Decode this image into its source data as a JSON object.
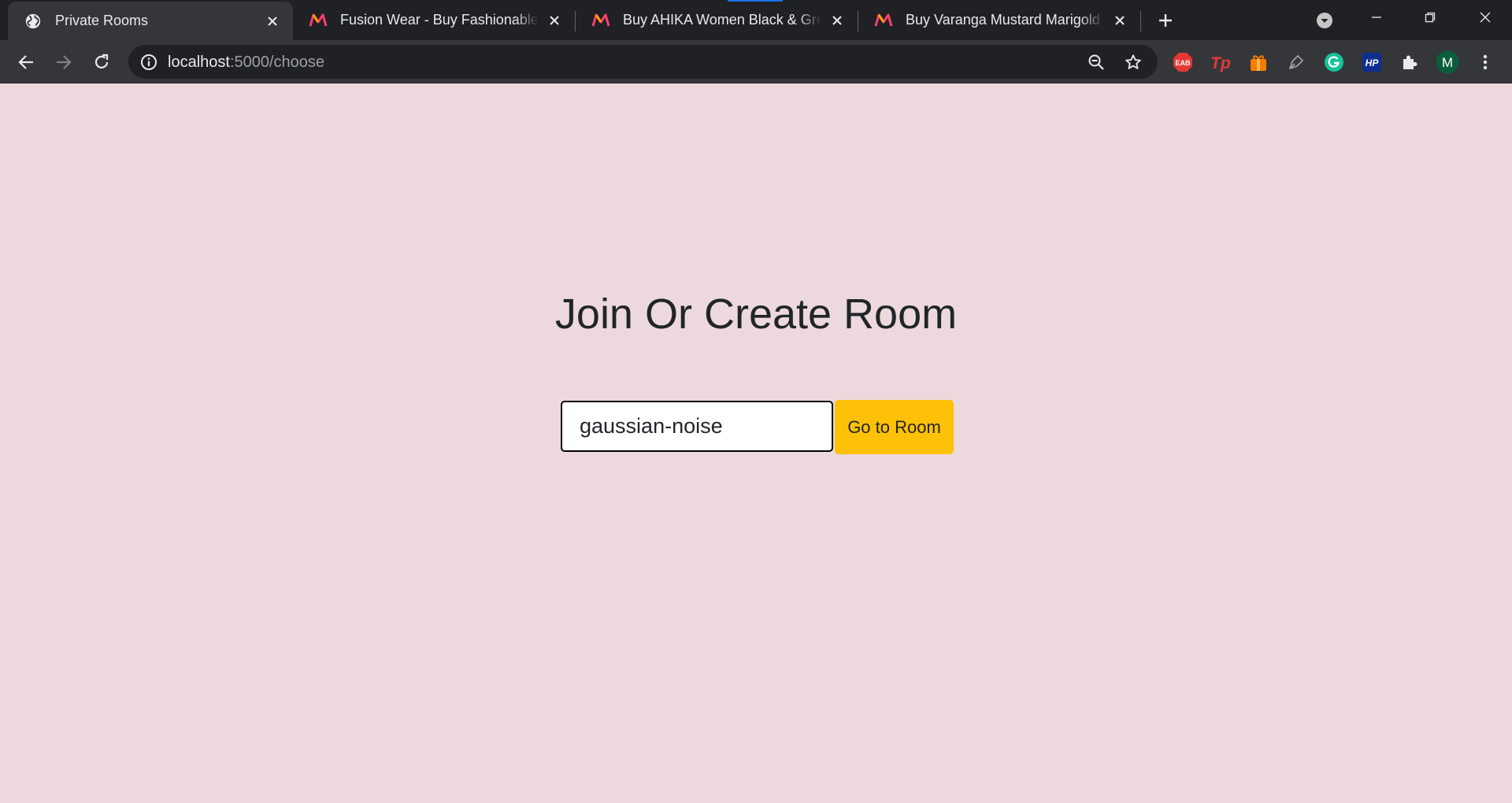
{
  "browser": {
    "tabs": [
      {
        "title": "Private Rooms",
        "active": true,
        "favicon": "globe-icon"
      },
      {
        "title": "Fusion Wear - Buy Fashionable Ethnic",
        "active": false,
        "favicon": "myntra-logo-icon"
      },
      {
        "title": "Buy AHIKA Women Black & Green",
        "active": false,
        "favicon": "myntra-logo-icon"
      },
      {
        "title": "Buy Varanga Mustard Marigold Cotton",
        "active": false,
        "favicon": "myntra-logo-icon"
      }
    ],
    "address": {
      "host": "localhost",
      "rest": ":5000/choose"
    },
    "extensions": [
      {
        "name": "eab-extension-icon",
        "label": "EAB",
        "color": "#e53935"
      },
      {
        "name": "tp-extension-icon",
        "label": "Tp",
        "color": "#e53935"
      },
      {
        "name": "gift-extension-icon",
        "label": "",
        "color": "#f57c00"
      },
      {
        "name": "pen-extension-icon",
        "label": "",
        "color": "#9aa0a6"
      },
      {
        "name": "grammarly-extension-icon",
        "label": "G",
        "color": "#15c39a"
      },
      {
        "name": "hp-extension-icon",
        "label": "HP",
        "color": "#0d2f8f"
      },
      {
        "name": "puzzle-extensions-icon",
        "label": "",
        "color": "#e8eaed"
      }
    ],
    "profile_initial": "M",
    "profile_color": "#0b5e3d"
  },
  "page": {
    "heading": "Join Or Create Room",
    "room_input_value": "gaussian-noise",
    "button_label": "Go to Room",
    "background_color": "#ecd8dd",
    "button_color": "#ffc107"
  }
}
